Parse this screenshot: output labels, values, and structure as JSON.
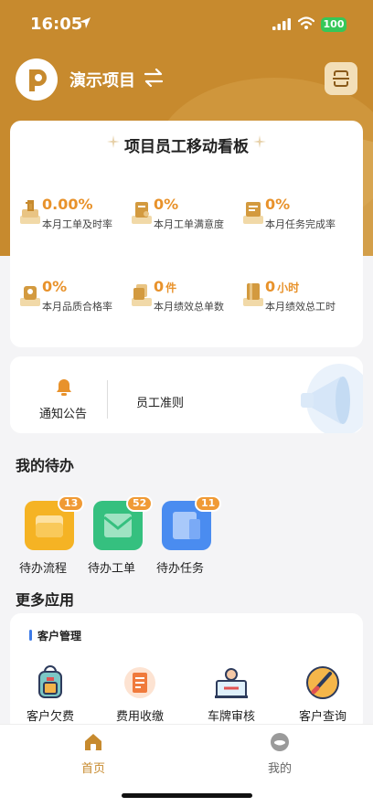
{
  "status_bar": {
    "time": "16:05",
    "battery": "100",
    "icons": [
      "location-arrow-icon",
      "signal-icon",
      "wifi-icon",
      "battery-icon"
    ]
  },
  "header": {
    "project_name": "演示项目",
    "icons": [
      "app-logo",
      "swap-icon",
      "scan-icon"
    ]
  },
  "dashboard": {
    "title": "项目员工移动看板",
    "stats": [
      {
        "value": "0.00%",
        "unit": "",
        "label": "本月工单及时率",
        "icon": "timeliness-icon"
      },
      {
        "value": "0%",
        "unit": "",
        "label": "本月工单满意度",
        "icon": "satisfaction-icon"
      },
      {
        "value": "0%",
        "unit": "",
        "label": "本月任务完成率",
        "icon": "task-completion-icon"
      },
      {
        "value": "0%",
        "unit": "",
        "label": "本月品质合格率",
        "icon": "quality-icon"
      },
      {
        "value": "0",
        "unit": "件",
        "label": "本月绩效总单数",
        "icon": "performance-orders-icon"
      },
      {
        "value": "0",
        "unit": "小时",
        "label": "本月绩效总工时",
        "icon": "performance-hours-icon"
      }
    ]
  },
  "notice": {
    "announce_label": "通知公告",
    "rules_label": "员工准则"
  },
  "todo": {
    "title": "我的待办",
    "items": [
      {
        "label": "待办流程",
        "count": "13",
        "color": "#f5b324"
      },
      {
        "label": "待办工单",
        "count": "52",
        "color": "#35c07f"
      },
      {
        "label": "待办任务",
        "count": "11",
        "color": "#4a8cf0"
      }
    ]
  },
  "more_apps": {
    "title": "更多应用",
    "group": "客户管理",
    "items": [
      {
        "label": "客户欠费",
        "icon": "backpack-icon"
      },
      {
        "label": "费用收缴",
        "icon": "bill-icon"
      },
      {
        "label": "车牌审核",
        "icon": "license-review-icon"
      },
      {
        "label": "客户查询",
        "icon": "paint-brush-icon"
      }
    ]
  },
  "tabbar": {
    "home": "首页",
    "mine": "我的"
  },
  "colors": {
    "brand": "#c78a2e",
    "accent": "#e8922b",
    "badge": "#f09a35"
  }
}
